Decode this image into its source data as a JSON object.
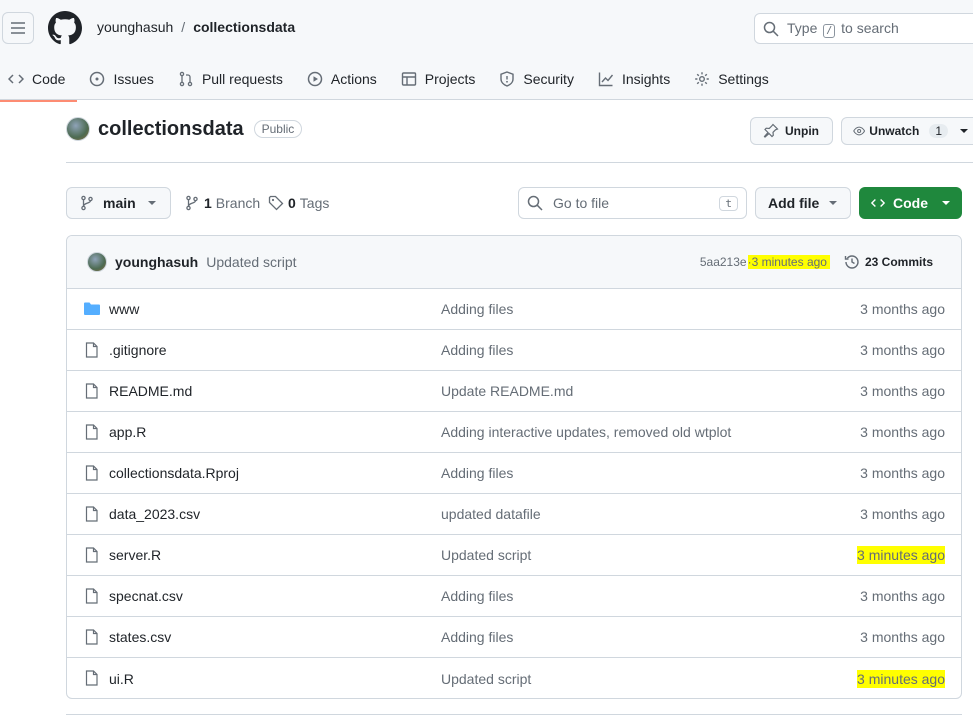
{
  "header": {
    "owner": "younghasuh",
    "separator": "/",
    "repo": "collectionsdata",
    "search_prefix": "Type",
    "search_key": "/",
    "search_suffix": "to search"
  },
  "tabs": [
    {
      "label": "Code",
      "icon": "code-icon",
      "active": true
    },
    {
      "label": "Issues",
      "icon": "issue-icon"
    },
    {
      "label": "Pull requests",
      "icon": "pull-request-icon"
    },
    {
      "label": "Actions",
      "icon": "play-icon"
    },
    {
      "label": "Projects",
      "icon": "table-icon"
    },
    {
      "label": "Security",
      "icon": "shield-icon"
    },
    {
      "label": "Insights",
      "icon": "graph-icon"
    },
    {
      "label": "Settings",
      "icon": "gear-icon"
    }
  ],
  "repo_header": {
    "name": "collectionsdata",
    "visibility": "Public",
    "unpin_label": "Unpin",
    "unwatch_label": "Unwatch",
    "watch_count": "1"
  },
  "branch_bar": {
    "branch": "main",
    "branches_count": "1",
    "branches_label": "Branch",
    "tags_count": "0",
    "tags_label": "Tags",
    "goto_placeholder": "Go to file",
    "goto_key": "t",
    "add_file_label": "Add file",
    "code_label": "Code"
  },
  "latest_commit": {
    "user": "younghasuh",
    "message": "Updated script",
    "sha": "5aa213e",
    "separator": "·",
    "age": "3 minutes ago",
    "commits_label": "23 Commits"
  },
  "files": [
    {
      "name": "www",
      "type": "folder",
      "message": "Adding files",
      "age": "3 months ago",
      "highlight": false
    },
    {
      "name": ".gitignore",
      "type": "file",
      "message": "Adding files",
      "age": "3 months ago",
      "highlight": false
    },
    {
      "name": "README.md",
      "type": "file",
      "message": "Update README.md",
      "age": "3 months ago",
      "highlight": false
    },
    {
      "name": "app.R",
      "type": "file",
      "message": "Adding interactive updates, removed old wtplot",
      "age": "3 months ago",
      "highlight": false
    },
    {
      "name": "collectionsdata.Rproj",
      "type": "file",
      "message": "Adding files",
      "age": "3 months ago",
      "highlight": false
    },
    {
      "name": "data_2023.csv",
      "type": "file",
      "message": "updated datafile",
      "age": "3 months ago",
      "highlight": false
    },
    {
      "name": "server.R",
      "type": "file",
      "message": "Updated script",
      "age": "3 minutes ago",
      "highlight": true
    },
    {
      "name": "specnat.csv",
      "type": "file",
      "message": "Adding files",
      "age": "3 months ago",
      "highlight": false
    },
    {
      "name": "states.csv",
      "type": "file",
      "message": "Adding files",
      "age": "3 months ago",
      "highlight": false
    },
    {
      "name": "ui.R",
      "type": "file",
      "message": "Updated script",
      "age": "3 minutes ago",
      "highlight": true
    }
  ],
  "colors": {
    "highlight": "#ffff00",
    "code_button": "#1f883d",
    "active_tab_underline": "#fd8c73",
    "folder": "#54aeff"
  }
}
